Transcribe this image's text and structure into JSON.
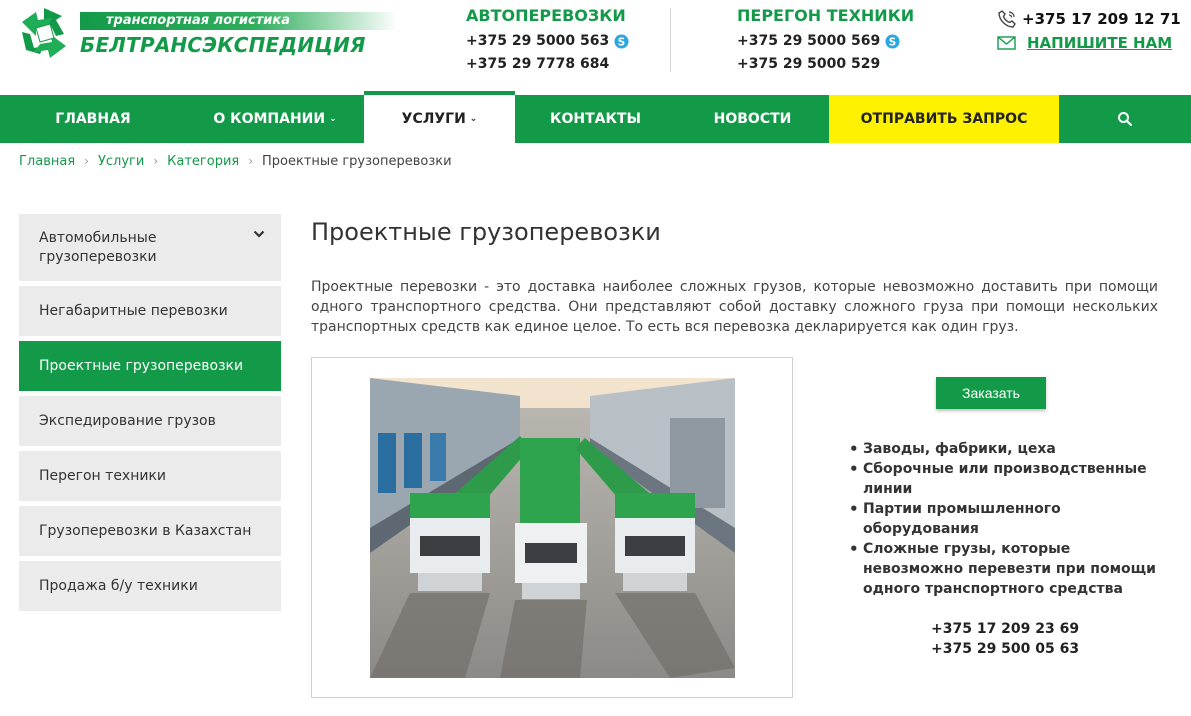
{
  "header": {
    "logo_tagline": "транспортная логистика",
    "logo_name": "БЕЛТРАНСЭКСПЕДИЦИЯ",
    "auto": {
      "title": "АВТОПЕРЕВОЗКИ",
      "phone1": "+375 29 5000 563",
      "phone2": "+375 29 7778 684"
    },
    "tech": {
      "title": "ПЕРЕГОН ТЕХНИКИ",
      "phone1": "+375 29 5000 569",
      "phone2": "+375 29 5000 529"
    },
    "main_phone": "+375 17 209 12 71",
    "write_us": "НАПИШИТЕ НАМ"
  },
  "nav": {
    "home": "ГЛАВНАЯ",
    "about": "О КОМПАНИИ",
    "services": "УСЛУГИ",
    "contacts": "КОНТАКТЫ",
    "news": "НОВОСТИ",
    "request": "ОТПРАВИТЬ ЗАПРОС"
  },
  "breadcrumb": {
    "home": "Главная",
    "services": "Услуги",
    "category": "Категория",
    "current": "Проектные грузоперевозки"
  },
  "sidebar": {
    "items": [
      "Автомобильные грузоперевозки",
      "Негабаритные перевозки",
      "Проектные грузоперевозки",
      "Экспедирование грузов",
      "Перегон техники",
      "Грузоперевозки в Казахстан",
      "Продажа б/у техники"
    ]
  },
  "main": {
    "title": "Проектные грузоперевозки",
    "intro": "Проектные перевозки - это доставка наиболее сложных грузов, которые невозможно доставить при помощи одного транспортного средства. Они представляют собой доставку сложного груза при помощи нескольких транспортных средств как единое целое. То есть вся перевозка декларируется как один груз.",
    "order_label": "Заказать",
    "features": [
      "Заводы, фабрики, цеха",
      "Сборочные или производственные линии",
      "Партии промышленного оборудования",
      "Сложные грузы, которые невозможно перевезти при помощи одного транспортного средства"
    ],
    "phones": [
      "+375 17 209 23 69",
      "+375 29 500 05 63"
    ]
  },
  "colors": {
    "brand_green": "#139a49",
    "request_yellow": "#fff200",
    "sidebar_gray": "#ebebeb"
  }
}
